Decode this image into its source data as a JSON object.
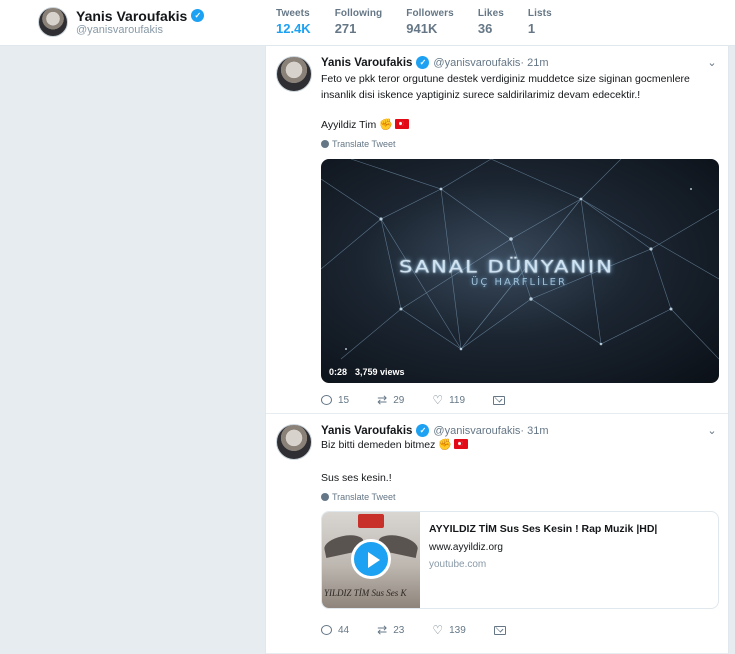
{
  "profile": {
    "name": "Yanis Varoufakis",
    "handle": "@yanisvaroufakis"
  },
  "stats": [
    {
      "label": "Tweets",
      "value": "12.4K",
      "active": true
    },
    {
      "label": "Following",
      "value": "271"
    },
    {
      "label": "Followers",
      "value": "941K"
    },
    {
      "label": "Likes",
      "value": "36"
    },
    {
      "label": "Lists",
      "value": "1"
    }
  ],
  "tweets": [
    {
      "name": "Yanis Varoufakis",
      "handle": "@yanisvaroufakis",
      "time": " · 21m",
      "text_line1": "Feto ve pkk teror orgutune destek verdiginiz muddetce size siginan gocmenlere insanlik disi iskence yaptiginiz surece saldirilarimiz devam edecektir.!",
      "text_line2": "Ayyildiz Tim",
      "translate": "Translate Tweet",
      "video": {
        "title": "SANAL DÜNYANIN",
        "subtitle": "ÜÇ HARFLİLER",
        "duration": "0:28",
        "views": "3,759 views"
      },
      "replies": "15",
      "retweets": "29",
      "likes": "119"
    },
    {
      "name": "Yanis Varoufakis",
      "handle": "@yanisvaroufakis",
      "time": " · 31m",
      "text_line1": "Biz bitti demeden bitmez",
      "text_line2": "Sus ses kesin.!",
      "translate": "Translate Tweet",
      "card": {
        "thumb_caption": "YILDIZ TİM Sus Ses K",
        "title": "AYYILDIZ TİM Sus Ses Kesin ! Rap Muzik |HD|",
        "description": "www.ayyildiz.org",
        "domain": "youtube.com"
      },
      "replies": "44",
      "retweets": "23",
      "likes": "139"
    }
  ],
  "colors": {
    "accent": "#1da1f2",
    "page_bg": "#e6ecf0",
    "muted": "#657786"
  },
  "icons": [
    "verified-badge-icon",
    "caret-down-icon",
    "globe-icon",
    "reply-icon",
    "retweet-icon",
    "like-heart-icon",
    "direct-message-icon",
    "play-icon"
  ]
}
